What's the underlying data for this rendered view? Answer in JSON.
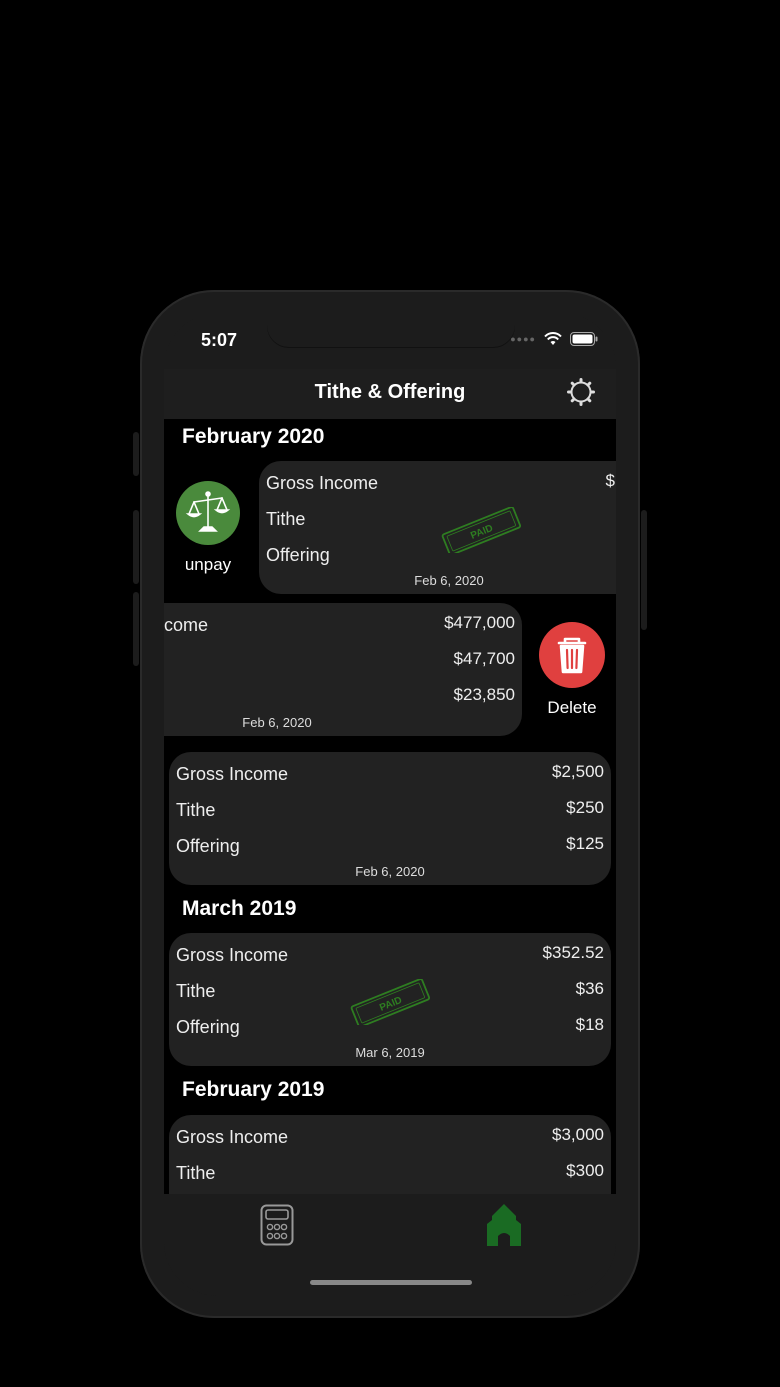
{
  "status": {
    "time": "5:07"
  },
  "navbar": {
    "title": "Tithe & Offering"
  },
  "sections": [
    {
      "title": "February 2020"
    },
    {
      "title": "March 2019"
    },
    {
      "title": "February 2019"
    }
  ],
  "cards": [
    {
      "labels": [
        "Gross Income",
        "Tithe",
        "Offering"
      ],
      "values": [
        "$",
        "",
        ""
      ],
      "date": "Feb 6, 2020",
      "paid": true
    },
    {
      "labels": [
        "come",
        "",
        ""
      ],
      "values": [
        "$477,000",
        "$47,700",
        "$23,850"
      ],
      "date": "Feb 6, 2020",
      "paid": false
    },
    {
      "labels": [
        "Gross Income",
        "Tithe",
        "Offering"
      ],
      "values": [
        "$2,500",
        "$250",
        "$125"
      ],
      "date": "Feb 6, 2020",
      "paid": false
    },
    {
      "labels": [
        "Gross Income",
        "Tithe",
        "Offering"
      ],
      "values": [
        "$352.52",
        "$36",
        "$18"
      ],
      "date": "Mar 6, 2019",
      "paid": true
    },
    {
      "labels": [
        "Gross Income",
        "Tithe"
      ],
      "values": [
        "$3,000",
        "$300"
      ],
      "date": "",
      "paid": false
    }
  ],
  "stamp_text": "PAID",
  "actions": {
    "unpay_label": "unpay",
    "delete_label": "Delete"
  },
  "colors": {
    "unpay": "#4a8a3c",
    "delete": "#e0403f",
    "paid_stamp": "#2e7d21",
    "home_tab": "#1a6b23"
  },
  "tabs": [
    {
      "name": "calculator-icon",
      "active": false
    },
    {
      "name": "church-icon",
      "active": true
    }
  ]
}
